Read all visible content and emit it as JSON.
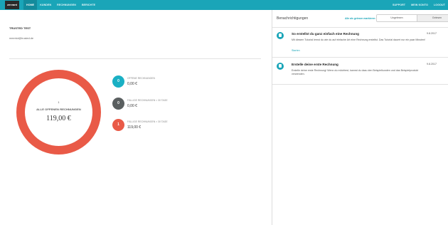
{
  "header": {
    "logo_text": "zervant",
    "nav_left": [
      "HOME",
      "KUNDEN",
      "RECHNUNGEN",
      "BERICHTE"
    ],
    "nav_right": [
      "SUPPORT",
      "MEIN KONTO",
      "LOGOUT"
    ],
    "accent_color": "#1aa5b8"
  },
  "company": {
    "name": "TRUSTED TEST",
    "email": "mmmlol@trusted.de"
  },
  "summary": {
    "count": "1",
    "label": "ALLE OFFENEN RECHNUNGEN",
    "amount": "119,00 €",
    "ring_color": "#e95a47"
  },
  "stats": [
    {
      "count": "0",
      "label": "OFFENE RECHNUNGEN",
      "value": "0,00 €",
      "color": "#1ab0c4"
    },
    {
      "count": "0",
      "label": "FÄLLIGE RECHNUNGEN < 30 TAGE",
      "value": "0,00 €",
      "color": "#5a5f60"
    },
    {
      "count": "1",
      "label": "FÄLLIGE RECHNUNGEN > 30 TAGE",
      "value": "119,00 €",
      "color": "#e95a47"
    }
  ],
  "notifications_panel": {
    "title": "Benachrichtigungen",
    "mark_all_read": "Alle als gelesen markieren",
    "filters": [
      "Ungelesen",
      "Gelesen"
    ],
    "selected_filter": "Gelesen"
  },
  "notifications": [
    {
      "title": "So erstellst du ganz einfach eine Rechnung",
      "date": "9.8.2017",
      "body": "Mit diesem Tutorial lernst du wie du auf einfache Art eine Rechnung erstellst. Das Tutorial dauert nur ein paar Minuten!",
      "link": "Starten"
    },
    {
      "title": "Erstelle deine erste Rechnung",
      "date": "9.8.2017",
      "body": "Erstelle deine erste Rechnung! Wenn du möchtest, kannst du dazu den Beispielkunden und das Beispielprodukt verwenden.",
      "link": ""
    }
  ]
}
